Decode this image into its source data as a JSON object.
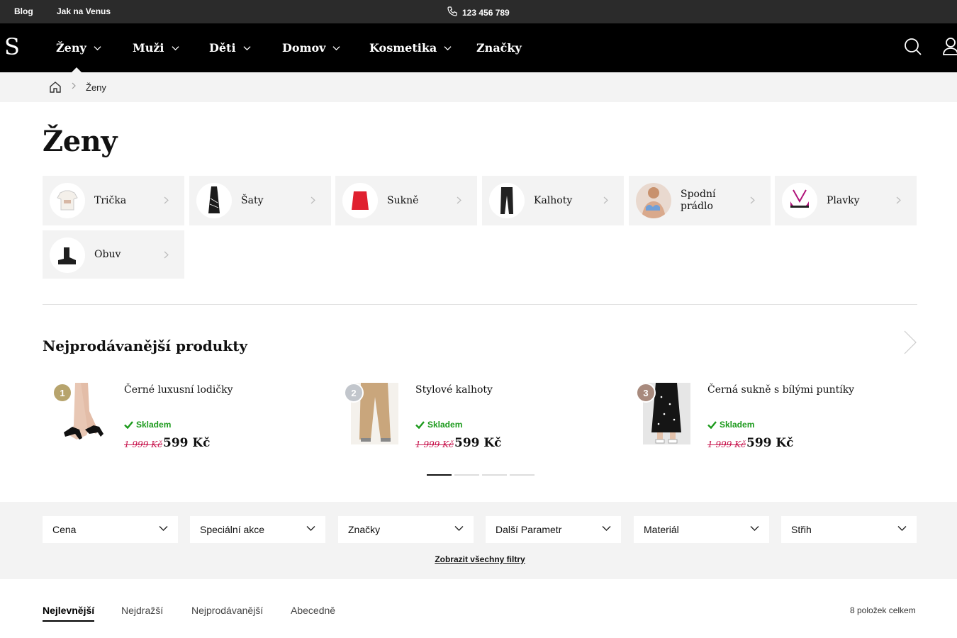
{
  "topbar": {
    "blog": "Blog",
    "venus": "Jak na Venus",
    "phone": "123 456 789"
  },
  "nav": {
    "logo": "S",
    "items": [
      "Ženy",
      "Muži",
      "Děti",
      "Domov",
      "Kosmetika",
      "Značky"
    ]
  },
  "breadcrumb": {
    "current": "Ženy"
  },
  "page_title": "Ženy",
  "categories": [
    {
      "label": "Trička",
      "icon": "tshirt-icon"
    },
    {
      "label": "Šaty",
      "icon": "dress-icon"
    },
    {
      "label": "Sukně",
      "icon": "skirt-icon"
    },
    {
      "label": "Kalhoty",
      "icon": "trousers-icon"
    },
    {
      "label": "Spodní prádlo",
      "icon": "lingerie-icon"
    },
    {
      "label": "Plavky",
      "icon": "swimwear-icon"
    },
    {
      "label": "Obuv",
      "icon": "shoe-icon"
    }
  ],
  "bestsellers": {
    "title": "Nejprodávanější produkty",
    "products": [
      {
        "rank": "1",
        "name": "Černé luxusní lodičky",
        "stock": "Skladem",
        "old_price": "1 999 Kč",
        "price": "599 Kč",
        "rank_color": "#b7a46d"
      },
      {
        "rank": "2",
        "name": "Stylové kalhoty",
        "stock": "Skladem",
        "old_price": "1 999 Kč",
        "price": "599 Kč",
        "rank_color": "#c2c6cc"
      },
      {
        "rank": "3",
        "name": "Černá sukně s bílými puntíky",
        "stock": "Skladem",
        "old_price": "1 999 Kč",
        "price": "599 Kč",
        "rank_color": "#a88a7d"
      }
    ],
    "pages": 4,
    "active_page": 1
  },
  "filters": {
    "items": [
      "Cena",
      "Speciální akce",
      "Značky",
      "Další Parametr",
      "Materiál",
      "Střih"
    ],
    "show_all": "Zobrazit všechny filtry"
  },
  "sorting": {
    "options": [
      "Nejlevnější",
      "Nejdražší",
      "Nejprodávanější",
      "Abecedně"
    ],
    "active": "Nejlevnější",
    "count": "8 položek celkem"
  },
  "colors": {
    "accent_green": "#1c9a1c",
    "old_price": "#c8174f",
    "nav_bg": "#000000"
  }
}
